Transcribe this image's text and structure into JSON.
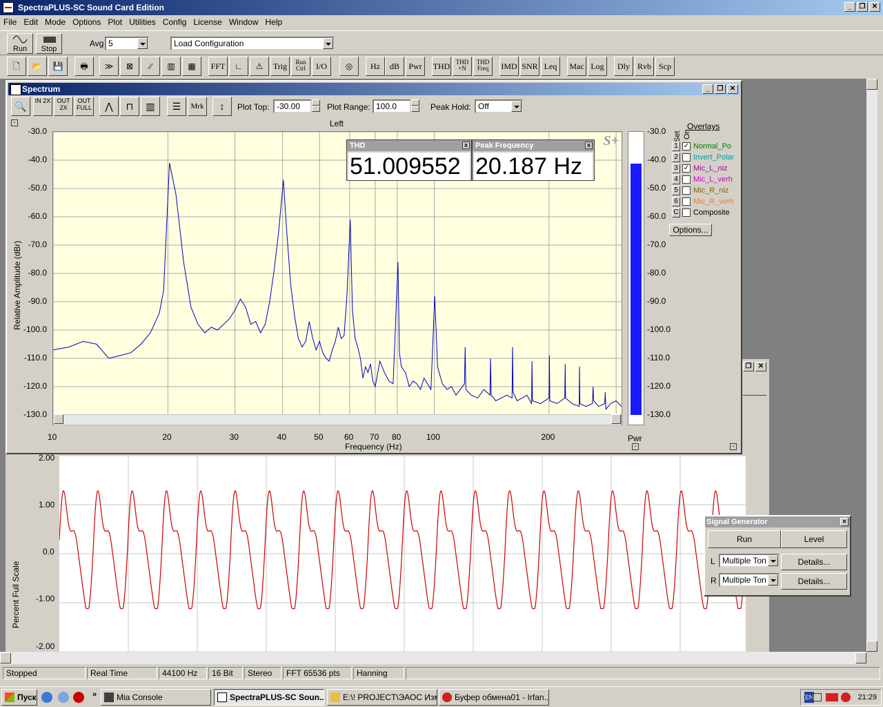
{
  "app": {
    "title": "SpectraPLUS-SC Sound Card Edition"
  },
  "window_controls": {
    "minimize": "_",
    "restore": "❐",
    "close": "✕"
  },
  "menu": [
    "File",
    "Edit",
    "Mode",
    "Options",
    "Plot",
    "Utilities",
    "Config",
    "License",
    "Window",
    "Help"
  ],
  "toolbar1": {
    "run_label": "Run",
    "stop_label": "Stop",
    "avg_label": "Avg",
    "avg_value": "5",
    "config_value": "Load Configuration"
  },
  "toolbar2": [
    "FFT",
    "Trig",
    "Run Ctrl",
    "I/O",
    "Hz",
    "dB",
    "Pwr",
    "THD",
    "THD +N",
    "THD Freq",
    "IMD",
    "SNR",
    "Leq",
    "Mac",
    "Log",
    "Dly",
    "Rvb",
    "Scp"
  ],
  "spectrum": {
    "title": "Spectrum",
    "plot_top_label": "Plot Top:",
    "plot_top_value": "-30.00",
    "plot_range_label": "Plot Range:",
    "plot_range_value": "100.0",
    "peak_hold_label": "Peak Hold:",
    "peak_hold_value": "Off",
    "zoom_in": "IN 2X",
    "zoom_out": "OUT 2X",
    "zoom_full": "OUT FULL",
    "mrk": "Mrk",
    "channel": "Left",
    "s_plus": "S+",
    "pwr_label": "Pwr",
    "thd_title": "THD",
    "thd_value": "51.009552",
    "peak_title": "Peak Frequency",
    "peak_value": "20.187 Hz",
    "overlays_title": "Overlays",
    "set_label": "Set",
    "on_label": "On",
    "options_btn": "Options...",
    "overlays": [
      {
        "num": "1",
        "checked": true,
        "name": "Normal_Po",
        "color": "#008000"
      },
      {
        "num": "2",
        "checked": false,
        "name": "Invert_Polar",
        "color": "#00a0a0"
      },
      {
        "num": "3",
        "checked": true,
        "name": "Mic_L_niz",
        "color": "#a000a0"
      },
      {
        "num": "4",
        "checked": false,
        "name": "Mic_L_verh",
        "color": "#d000d0"
      },
      {
        "num": "5",
        "checked": false,
        "name": "Mic_R_niz",
        "color": "#806000"
      },
      {
        "num": "6",
        "checked": false,
        "name": "Mic_R_verh",
        "color": "#e08040"
      },
      {
        "num": "C",
        "checked": false,
        "name": "Composite",
        "color": "#000000"
      }
    ]
  },
  "chart_data": [
    {
      "type": "line",
      "title": "",
      "xlabel": "Frequency (Hz)",
      "ylabel": "Relative Amplitude (dBr)",
      "x_scale": "log",
      "xlim": [
        10,
        310
      ],
      "ylim": [
        -130,
        -30
      ],
      "x_ticks": [
        "10",
        "20",
        "30",
        "40",
        "50",
        "60",
        "70",
        "80",
        "100",
        "200"
      ],
      "y_ticks": [
        "-30.0",
        "-40.0",
        "-50.0",
        "-60.0",
        "-70.0",
        "-80.0",
        "-90.0",
        "-100.0",
        "-110.0",
        "-120.0",
        "-130.0"
      ],
      "grid": true,
      "series_color": "#0000c0",
      "x": [
        10,
        11,
        12,
        13,
        14,
        15,
        16,
        17,
        18,
        19,
        19.5,
        20.2,
        21,
        22,
        23,
        24,
        25,
        26,
        27,
        28,
        29,
        30,
        31,
        32,
        33,
        34,
        35,
        36,
        37,
        38,
        39,
        40.2,
        41,
        42,
        43,
        44,
        45,
        46,
        47,
        48,
        49,
        50,
        51,
        52,
        53,
        54,
        55,
        56,
        57,
        58,
        59,
        60.2,
        61,
        62,
        63,
        64,
        65,
        66,
        67,
        68,
        69,
        70,
        72,
        74,
        76,
        78,
        79,
        80.3,
        81,
        82,
        84,
        86,
        88,
        90,
        92,
        94,
        96,
        98,
        100.3,
        102,
        105,
        108,
        111,
        114,
        117,
        120,
        120.5,
        121,
        125,
        130,
        135,
        140,
        140.5,
        141,
        145,
        150,
        155,
        160,
        160.5,
        161,
        165,
        170,
        175,
        180,
        180.5,
        181,
        190,
        200,
        200.5,
        201,
        210,
        220,
        220.5,
        221,
        230,
        240,
        240.5,
        241,
        250,
        260,
        261,
        262,
        270,
        280,
        281,
        282,
        290,
        300,
        310
      ],
      "values": [
        -107,
        -106,
        -104,
        -105,
        -110,
        -109,
        -108,
        -105,
        -101,
        -94,
        -86,
        -41,
        -52,
        -76,
        -92,
        -98,
        -101,
        -99,
        -100,
        -98,
        -96,
        -93,
        -89,
        -92,
        -98,
        -97,
        -101,
        -98,
        -90,
        -79,
        -66,
        -47,
        -65,
        -84,
        -95,
        -103,
        -106,
        -104,
        -97,
        -103,
        -107,
        -104,
        -108,
        -110,
        -111,
        -107,
        -104,
        -99,
        -103,
        -102,
        -88,
        -61,
        -93,
        -103,
        -106,
        -110,
        -117,
        -113,
        -115,
        -112,
        -118,
        -120,
        -111,
        -115,
        -118,
        -119,
        -100,
        -76,
        -108,
        -113,
        -115,
        -120,
        -118,
        -119,
        -121,
        -117,
        -119,
        -121,
        -88,
        -113,
        -119,
        -121,
        -120,
        -123,
        -121,
        -119,
        -106,
        -121,
        -123,
        -124,
        -121,
        -123,
        -110,
        -123,
        -125,
        -124,
        -123,
        -124,
        -106,
        -122,
        -125,
        -124,
        -123,
        -126,
        -111,
        -125,
        -126,
        -124,
        -109,
        -125,
        -126,
        -124,
        -112,
        -124,
        -126,
        -127,
        -113,
        -126,
        -127,
        -126,
        -120,
        -125,
        -127,
        -126,
        -122,
        -128,
        -126,
        -125,
        -127
      ]
    },
    {
      "type": "line",
      "title": "",
      "xlabel": "",
      "ylabel": "Percent Full Scale",
      "ylim": [
        -2.0,
        2.0
      ],
      "y_ticks": [
        "2.00",
        "1.00",
        "0.0",
        "-1.00",
        "-2.00"
      ],
      "grid": true,
      "series_color": "#cc0000",
      "cycles_visible": 20,
      "peak": 1.38,
      "trough": -1.12
    }
  ],
  "pwr_meter": {
    "level": -40.8,
    "range": [
      -130,
      -30
    ]
  },
  "siggen": {
    "title": "Signal Generator",
    "run": "Run",
    "level": "Level",
    "l_label": "L",
    "r_label": "R",
    "l_value": "Multiple Ton",
    "r_value": "Multiple Ton",
    "details": "Details..."
  },
  "status": [
    "Stopped",
    "Real Time",
    "44100 Hz",
    "16 Bit",
    "Stereo",
    "FFT 65536 pts",
    "Hanning"
  ],
  "taskbar": {
    "start": "Пуск",
    "items": [
      {
        "label": "Mia Console",
        "active": false
      },
      {
        "label": "SpectraPLUS-SC Soun...",
        "active": true
      },
      {
        "label": "E:\\! PROJECT\\ЭАОС Изм...",
        "active": false
      },
      {
        "label": "Буфер обмена01 - Irfan...",
        "active": false
      }
    ],
    "lang": "EN",
    "time": "21:29"
  }
}
